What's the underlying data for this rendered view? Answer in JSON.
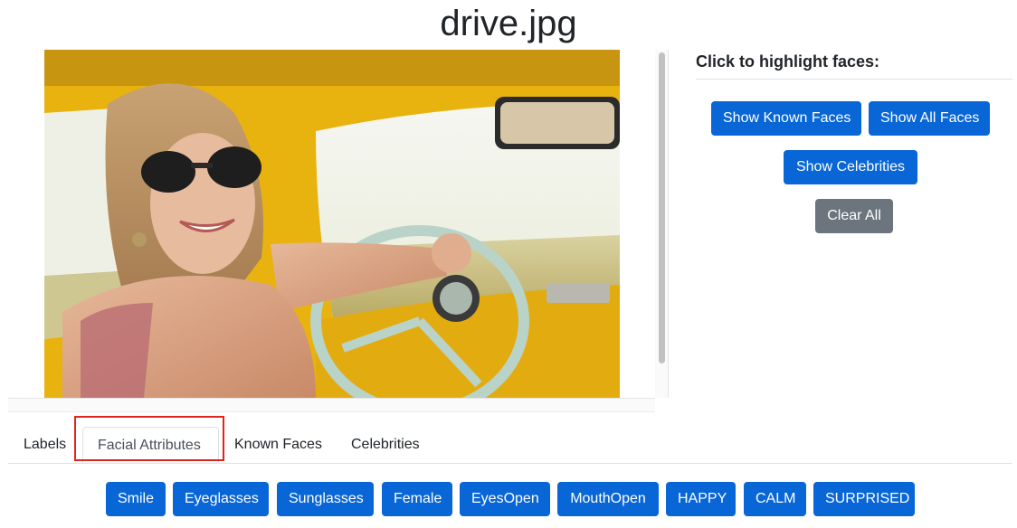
{
  "page": {
    "title": "drive.jpg"
  },
  "side_panel": {
    "heading": "Click to highlight faces:",
    "buttons": {
      "show_known_faces": "Show Known Faces",
      "show_all_faces": "Show All Faces",
      "show_celebrities": "Show Celebrities",
      "clear_all": "Clear All"
    }
  },
  "tabs": [
    {
      "label": "Labels",
      "active": false
    },
    {
      "label": "Facial Attributes",
      "active": true
    },
    {
      "label": "Known Faces",
      "active": false
    },
    {
      "label": "Celebrities",
      "active": false
    }
  ],
  "facial_attributes": [
    "Smile",
    "Eyeglasses",
    "Sunglasses",
    "Female",
    "EyesOpen",
    "MouthOpen",
    "HAPPY",
    "CALM",
    "SURPRISED"
  ],
  "colors": {
    "primary": "#0866d6",
    "secondary": "#6c757d",
    "highlight": "#e3241d"
  }
}
